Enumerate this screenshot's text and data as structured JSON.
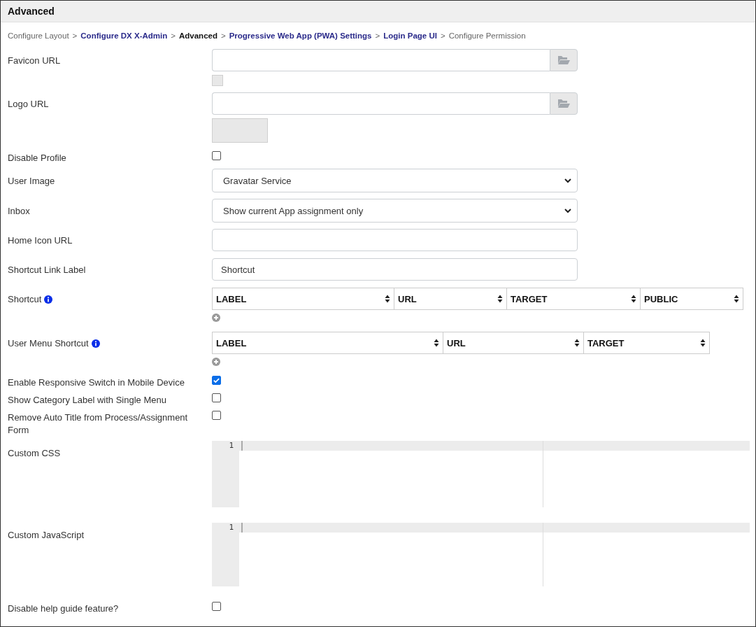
{
  "panel": {
    "title": "Advanced"
  },
  "breadcrumb": {
    "separator": ">",
    "items": [
      {
        "label": "Configure Layout",
        "kind": "plain"
      },
      {
        "label": "Configure DX X-Admin",
        "kind": "link"
      },
      {
        "label": "Advanced",
        "kind": "current"
      },
      {
        "label": "Progressive Web App (PWA) Settings",
        "kind": "link"
      },
      {
        "label": "Login Page UI",
        "kind": "link"
      },
      {
        "label": "Configure Permission",
        "kind": "plain"
      }
    ]
  },
  "fields": [
    {
      "label": "Favicon URL",
      "kind": "icon-file"
    },
    {
      "label": "Logo URL",
      "kind": "image-file"
    },
    {
      "label": "Disable Profile",
      "kind": "checkbox",
      "checked": false
    },
    {
      "label": "User Image",
      "kind": "select",
      "value": "Gravatar Service"
    },
    {
      "label": "Inbox",
      "kind": "select",
      "value": "Show current App assignment only"
    },
    {
      "label": "Home Icon URL",
      "kind": "text"
    },
    {
      "label": "Shortcut Link Label",
      "kind": "text",
      "value": "Shortcut"
    },
    {
      "label": "Shortcut",
      "kind": "table",
      "columns": [
        "LABEL",
        "URL",
        "TARGET",
        "PUBLIC"
      ]
    },
    {
      "label": "User Menu Shortcut",
      "kind": "table",
      "columns": [
        "LABEL",
        "URL",
        "TARGET"
      ]
    },
    {
      "label": "Enable Responsive Switch in Mobile Device",
      "kind": "checkbox",
      "checked": true
    },
    {
      "label": "Show Category Label with Single Menu",
      "kind": "checkbox",
      "checked": false
    },
    {
      "label": "Remove Auto Title from Process/Assignment Form",
      "kind": "checkbox",
      "checked": false
    },
    {
      "label": "Custom CSS",
      "kind": "code",
      "line_numbers": [
        "1"
      ]
    },
    {
      "label": "Custom JavaScript",
      "kind": "code",
      "line_numbers": [
        "1"
      ]
    },
    {
      "label": "Disable help guide feature?",
      "kind": "checkbox",
      "checked": false
    }
  ]
}
